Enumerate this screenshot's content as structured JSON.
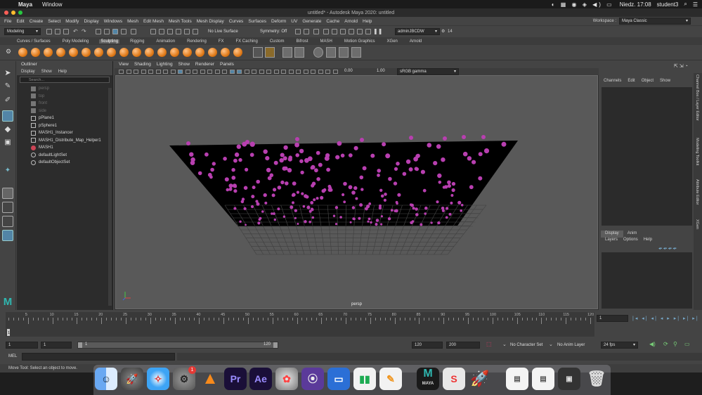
{
  "mac_menubar": {
    "app": "Maya",
    "menu": [
      "Window"
    ],
    "clock": "Niedz. 17:08",
    "user": "student3"
  },
  "window": {
    "title": "untitled* - Autodesk Maya 2020: untitled"
  },
  "menus": [
    "File",
    "Edit",
    "Create",
    "Select",
    "Modify",
    "Display",
    "Windows",
    "Mesh",
    "Edit Mesh",
    "Mesh Tools",
    "Mesh Display",
    "Curves",
    "Surfaces",
    "Deform",
    "UV",
    "Generate",
    "Cache",
    "Arnold",
    "Help"
  ],
  "workspace": {
    "label": "Workspace :",
    "value": "Maya Classic"
  },
  "statusline": {
    "mode": "Modeling",
    "live_surface": "No Live Surface",
    "symmetry": "Symmetry: Off",
    "user_combo": "adminJBCDW",
    "count": "14"
  },
  "shelf_tabs": [
    "Curves / Surfaces",
    "Poly Modeling",
    "Sculpting",
    "Rigging",
    "Animation",
    "Rendering",
    "FX",
    "FX Caching",
    "Custom",
    "Bifrost",
    "MASH",
    "Motion Graphics",
    "XGen",
    "Arnold"
  ],
  "shelf_active": "Sculpting",
  "outliner": {
    "title": "Outliner",
    "menu": [
      "Display",
      "Show",
      "Help"
    ],
    "search_placeholder": "Search...",
    "items": [
      {
        "label": "persp",
        "dim": true
      },
      {
        "label": "top",
        "dim": true
      },
      {
        "label": "front",
        "dim": true
      },
      {
        "label": "side",
        "dim": true
      },
      {
        "label": "pPlane1",
        "dim": false
      },
      {
        "label": "pSphere1",
        "dim": false
      },
      {
        "label": "MASH1_Instancer",
        "dim": false
      },
      {
        "label": "MASH1_Distribute_Map_Helper1",
        "dim": false
      },
      {
        "label": "MASH1",
        "dim": false
      },
      {
        "label": "defaultLightSet",
        "dim": false
      },
      {
        "label": "defaultObjectSet",
        "dim": false
      }
    ]
  },
  "viewport": {
    "menu": [
      "View",
      "Shading",
      "Lighting",
      "Show",
      "Renderer",
      "Panels"
    ],
    "exposure": "0.00",
    "gamma": "1.00",
    "color_space": "sRGB gamma",
    "camera_label": "persp"
  },
  "channel_box": {
    "menu": [
      "Channels",
      "Edit",
      "Object",
      "Show"
    ],
    "tabs": [
      "Display",
      "Anim"
    ],
    "tab_menu": [
      "Layers",
      "Options",
      "Help"
    ]
  },
  "side_tabs": [
    "Channel Box / Layer Editor",
    "Modeling Toolkit",
    "Attribute Editor",
    "XGen"
  ],
  "timeline": {
    "ticks": [
      "5",
      "10",
      "15",
      "20",
      "25",
      "30",
      "35",
      "40",
      "45",
      "50",
      "55",
      "60",
      "65",
      "70",
      "75",
      "80",
      "85",
      "90",
      "95",
      "100",
      "105",
      "110",
      "115",
      "120"
    ],
    "current_frame": "1",
    "current_frame_left": "1"
  },
  "range": {
    "start": "1",
    "inner_start": "1",
    "slider_start": "1",
    "slider_end": "120",
    "end": "120",
    "anim_end": "200",
    "character_set": "No Character Set",
    "anim_layer": "No Anim Layer",
    "fps": "24 fps"
  },
  "mel_label": "MEL",
  "help_line": "Move Tool: Select an object to move.",
  "dock": {
    "apps": [
      "Finder",
      "Launchpad",
      "Safari",
      "System Preferences",
      "VLC",
      "Premiere Pro",
      "After Effects",
      "DaVinci Resolve",
      "Motion",
      "Keynote",
      "Numbers",
      "Pages",
      "Maya",
      "Substance Painter",
      "Rocket",
      "Preview",
      "Finder Document",
      "Screenshot",
      "Trash"
    ],
    "badge": "1",
    "pr_label": "Pr",
    "ae_label": "Ae",
    "maya_label": "MAYA"
  },
  "colors": {
    "accent": "#5285a6",
    "sphere": "#b83fb0"
  }
}
